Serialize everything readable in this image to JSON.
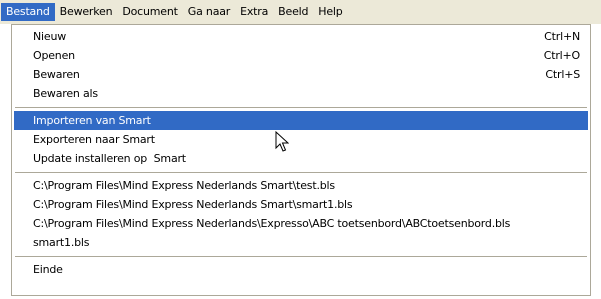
{
  "menubar": {
    "items": [
      {
        "label": "Bestand"
      },
      {
        "label": "Bewerken"
      },
      {
        "label": "Document"
      },
      {
        "label": "Ga naar"
      },
      {
        "label": "Extra"
      },
      {
        "label": "Beeld"
      },
      {
        "label": "Help"
      }
    ],
    "active_index": 0
  },
  "menu": {
    "group1": [
      {
        "label": "Nieuw",
        "shortcut": "Ctrl+N"
      },
      {
        "label": "Openen",
        "shortcut": "Ctrl+O"
      },
      {
        "label": "Bewaren",
        "shortcut": "Ctrl+S"
      },
      {
        "label": "Bewaren als"
      }
    ],
    "group2": [
      {
        "label": "Importeren van Smart",
        "highlighted": true
      },
      {
        "label": "Exporteren naar Smart"
      },
      {
        "label": "Update installeren op  Smart"
      }
    ],
    "recent_files": [
      {
        "label": "C:\\Program Files\\Mind Express Nederlands Smart\\test.bls"
      },
      {
        "label": "C:\\Program Files\\Mind Express Nederlands Smart\\smart1.bls"
      },
      {
        "label": "C:\\Program Files\\Mind Express Nederlands\\Expresso\\ABC toetsenbord\\ABCtoetsenbord.bls"
      },
      {
        "label": "smart1.bls"
      }
    ],
    "exit": {
      "label": "Einde"
    }
  },
  "colors": {
    "highlight": "#316ac5",
    "menubar_bg": "#ece9d8",
    "border": "#aca899"
  },
  "cursor": {
    "icon": "arrow-pointer-icon"
  }
}
